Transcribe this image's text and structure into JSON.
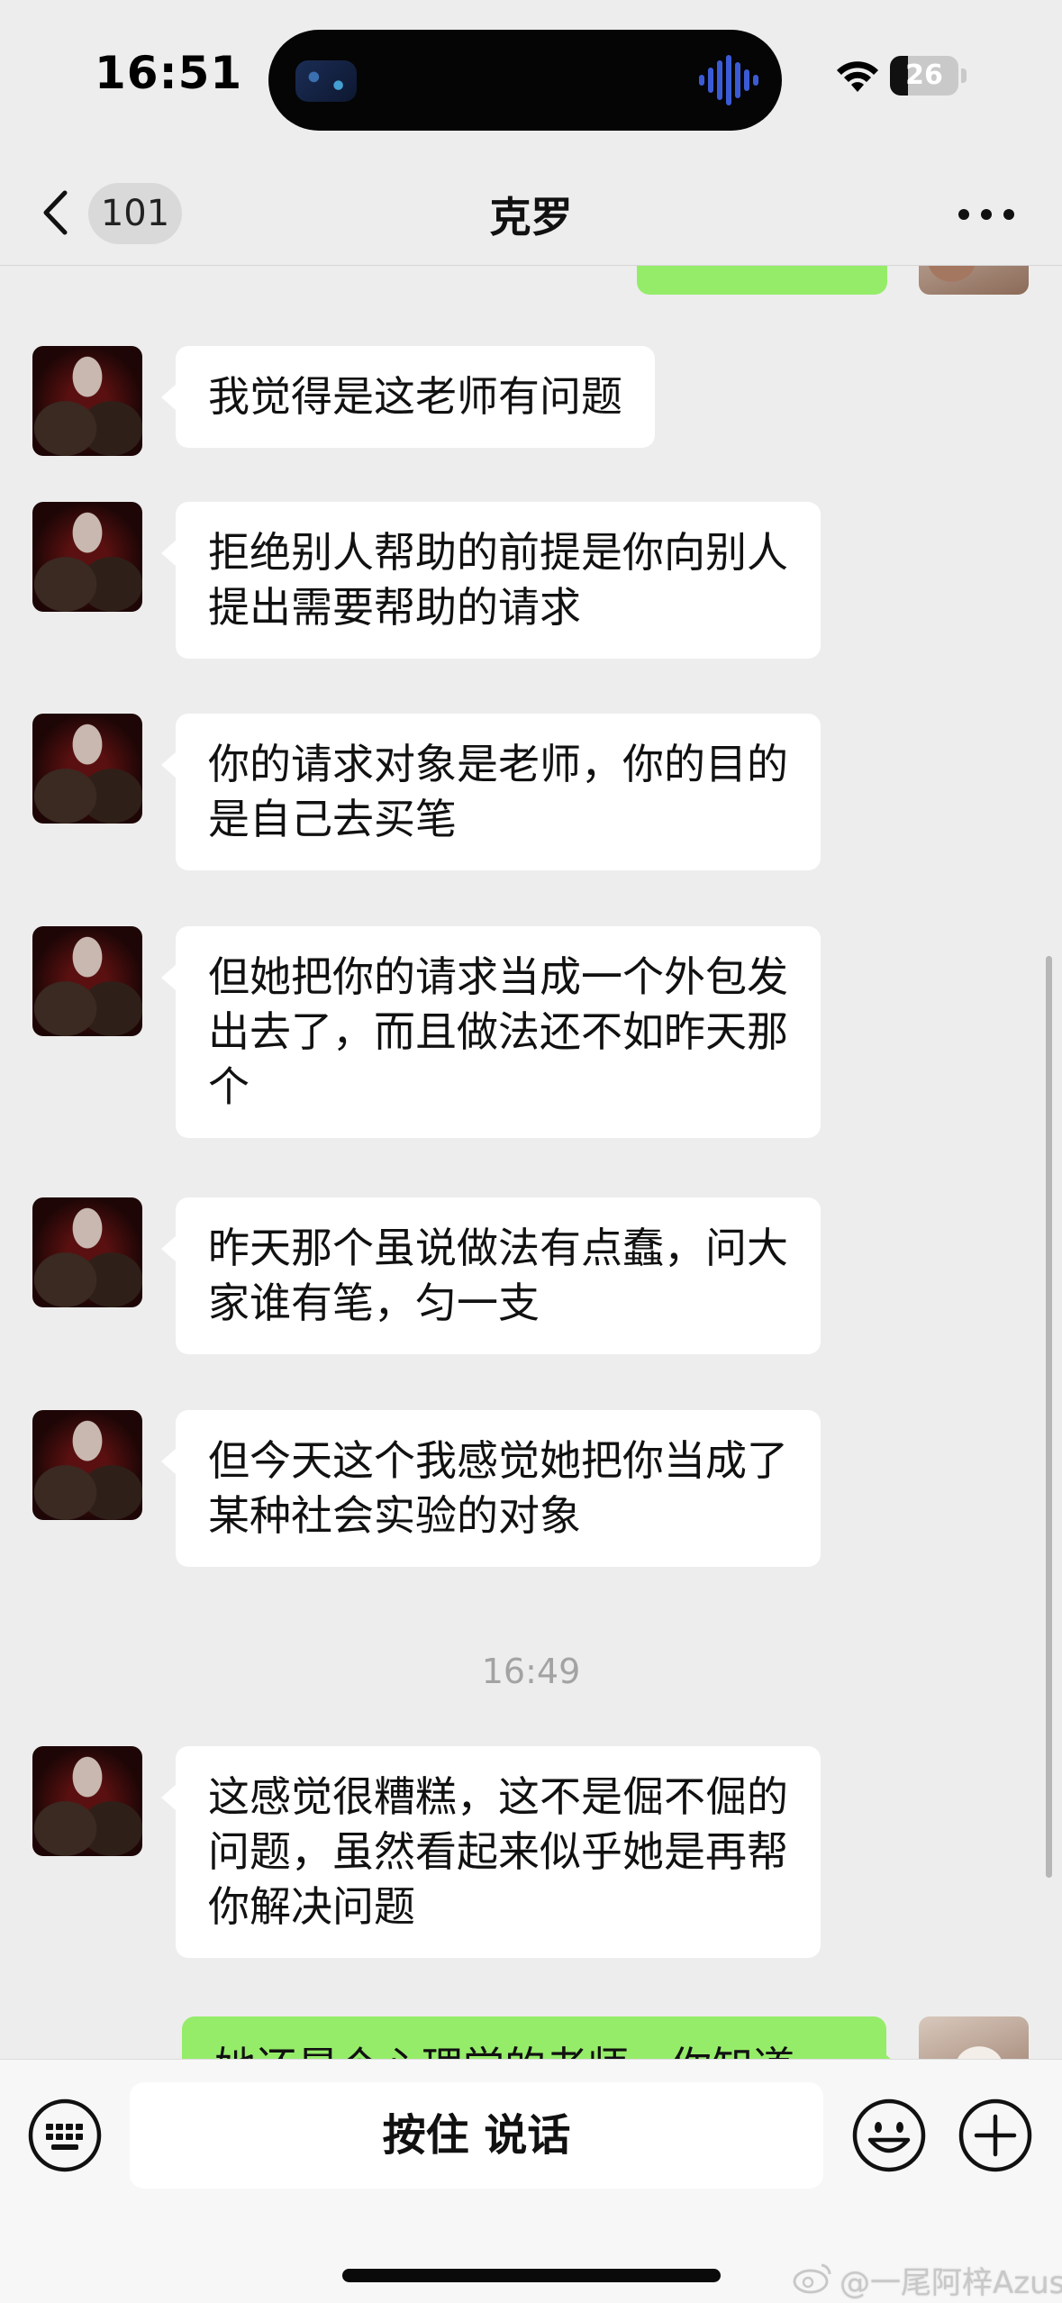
{
  "status_bar": {
    "time": "16:51",
    "battery_percent": "26",
    "battery_level": 0.26
  },
  "nav": {
    "unread_count": "101",
    "title": "克罗"
  },
  "messages": [
    {
      "sender": "them",
      "text": "我觉得是这老师有问题"
    },
    {
      "sender": "them",
      "text": "拒绝别人帮助的前提是你向别人\n提出需要帮助的请求"
    },
    {
      "sender": "them",
      "text": "你的请求对象是老师，你的目的\n是自己去买笔"
    },
    {
      "sender": "them",
      "text": "但她把你的请求当成一个外包发\n出去了，而且做法还不如昨天那\n个"
    },
    {
      "sender": "them",
      "text": "昨天那个虽说做法有点蠢，问大\n家谁有笔，匀一支"
    },
    {
      "sender": "them",
      "text": "但今天这个我感觉她把你当成了\n某种社会实验的对象"
    },
    {
      "sender": "them",
      "text": "这感觉很糟糕，这不是倔不倔的\n问题，虽然看起来似乎她是再帮\n你解决问题"
    },
    {
      "sender": "me",
      "text": "她还是个心理学的老师，你知道"
    }
  ],
  "time_divider": "16:49",
  "input_bar": {
    "hold_to_talk_label": "按住 说话",
    "left_icon": "keyboard-icon",
    "emoji_icon": "emoji-icon",
    "plus_icon": "plus-icon"
  },
  "watermark": "@一尾阿梓Azusa",
  "colors": {
    "background": "#ededed",
    "my_bubble": "#95ec69",
    "their_bubble": "#ffffff"
  }
}
